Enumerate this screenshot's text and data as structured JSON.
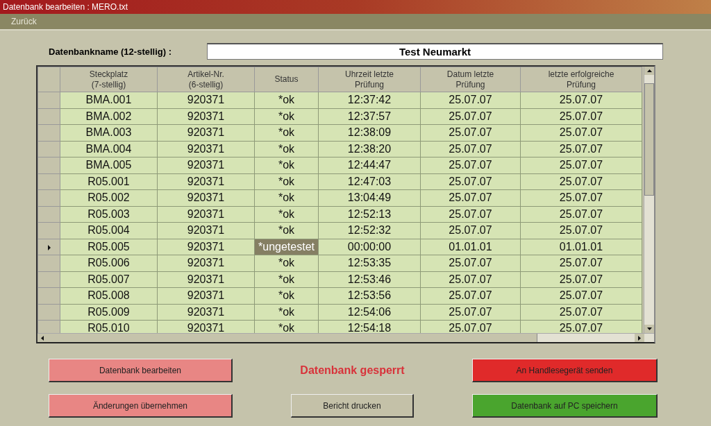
{
  "window": {
    "title": "Datenbank bearbeiten : MERO.txt"
  },
  "menu": [
    "Zurück"
  ],
  "database_name": {
    "label": "Datenbankname (12-stellig) :",
    "value": "Test Neumarkt"
  },
  "table": {
    "columns": [
      "Steckplatz\n(7-stellig)",
      "Artikel-Nr.\n(6-stellig)",
      "Status",
      "Uhrzeit letzte\nPrüfung",
      "Datum letzte\nPrüfung",
      "letzte erfolgreiche\nPrüfung"
    ],
    "rows": [
      {
        "selected": false,
        "cells": [
          "BMA.001",
          "920371",
          "*ok",
          "12:37:42",
          "25.07.07",
          "25.07.07"
        ]
      },
      {
        "selected": false,
        "cells": [
          "BMA.002",
          "920371",
          "*ok",
          "12:37:57",
          "25.07.07",
          "25.07.07"
        ]
      },
      {
        "selected": false,
        "cells": [
          "BMA.003",
          "920371",
          "*ok",
          "12:38:09",
          "25.07.07",
          "25.07.07"
        ]
      },
      {
        "selected": false,
        "cells": [
          "BMA.004",
          "920371",
          "*ok",
          "12:38:20",
          "25.07.07",
          "25.07.07"
        ]
      },
      {
        "selected": false,
        "cells": [
          "BMA.005",
          "920371",
          "*ok",
          "12:44:47",
          "25.07.07",
          "25.07.07"
        ]
      },
      {
        "selected": false,
        "cells": [
          "R05.001",
          "920371",
          "*ok",
          "12:47:03",
          "25.07.07",
          "25.07.07"
        ]
      },
      {
        "selected": false,
        "cells": [
          "R05.002",
          "920371",
          "*ok",
          "13:04:49",
          "25.07.07",
          "25.07.07"
        ]
      },
      {
        "selected": false,
        "cells": [
          "R05.003",
          "920371",
          "*ok",
          "12:52:13",
          "25.07.07",
          "25.07.07"
        ]
      },
      {
        "selected": false,
        "cells": [
          "R05.004",
          "920371",
          "*ok",
          "12:52:32",
          "25.07.07",
          "25.07.07"
        ]
      },
      {
        "selected": true,
        "cells": [
          "R05.005",
          "920371",
          "*ungetestet",
          "00:00:00",
          "01.01.01",
          "01.01.01"
        ]
      },
      {
        "selected": false,
        "cells": [
          "R05.006",
          "920371",
          "*ok",
          "12:53:35",
          "25.07.07",
          "25.07.07"
        ]
      },
      {
        "selected": false,
        "cells": [
          "R05.007",
          "920371",
          "*ok",
          "12:53:46",
          "25.07.07",
          "25.07.07"
        ]
      },
      {
        "selected": false,
        "cells": [
          "R05.008",
          "920371",
          "*ok",
          "12:53:56",
          "25.07.07",
          "25.07.07"
        ]
      },
      {
        "selected": false,
        "cells": [
          "R05.009",
          "920371",
          "*ok",
          "12:54:06",
          "25.07.07",
          "25.07.07"
        ]
      },
      {
        "selected": false,
        "cells": [
          "R05.010",
          "920371",
          "*ok",
          "12:54:18",
          "25.07.07",
          "25.07.07"
        ]
      }
    ]
  },
  "buttons": [
    {
      "label": "Datenbank bearbeiten",
      "color": "#e88684"
    },
    {
      "label": "An Handlesegerät senden",
      "color": "#e02a2a"
    },
    {
      "label": "Änderungen übernehmen",
      "color": "#e88684"
    },
    {
      "label": "Bericht drucken",
      "color": "#c4c1a8"
    },
    {
      "label": "Datenbank auf PC speichern",
      "color": "#4aa52e"
    }
  ],
  "lock_status": "Datenbank gesperrt"
}
